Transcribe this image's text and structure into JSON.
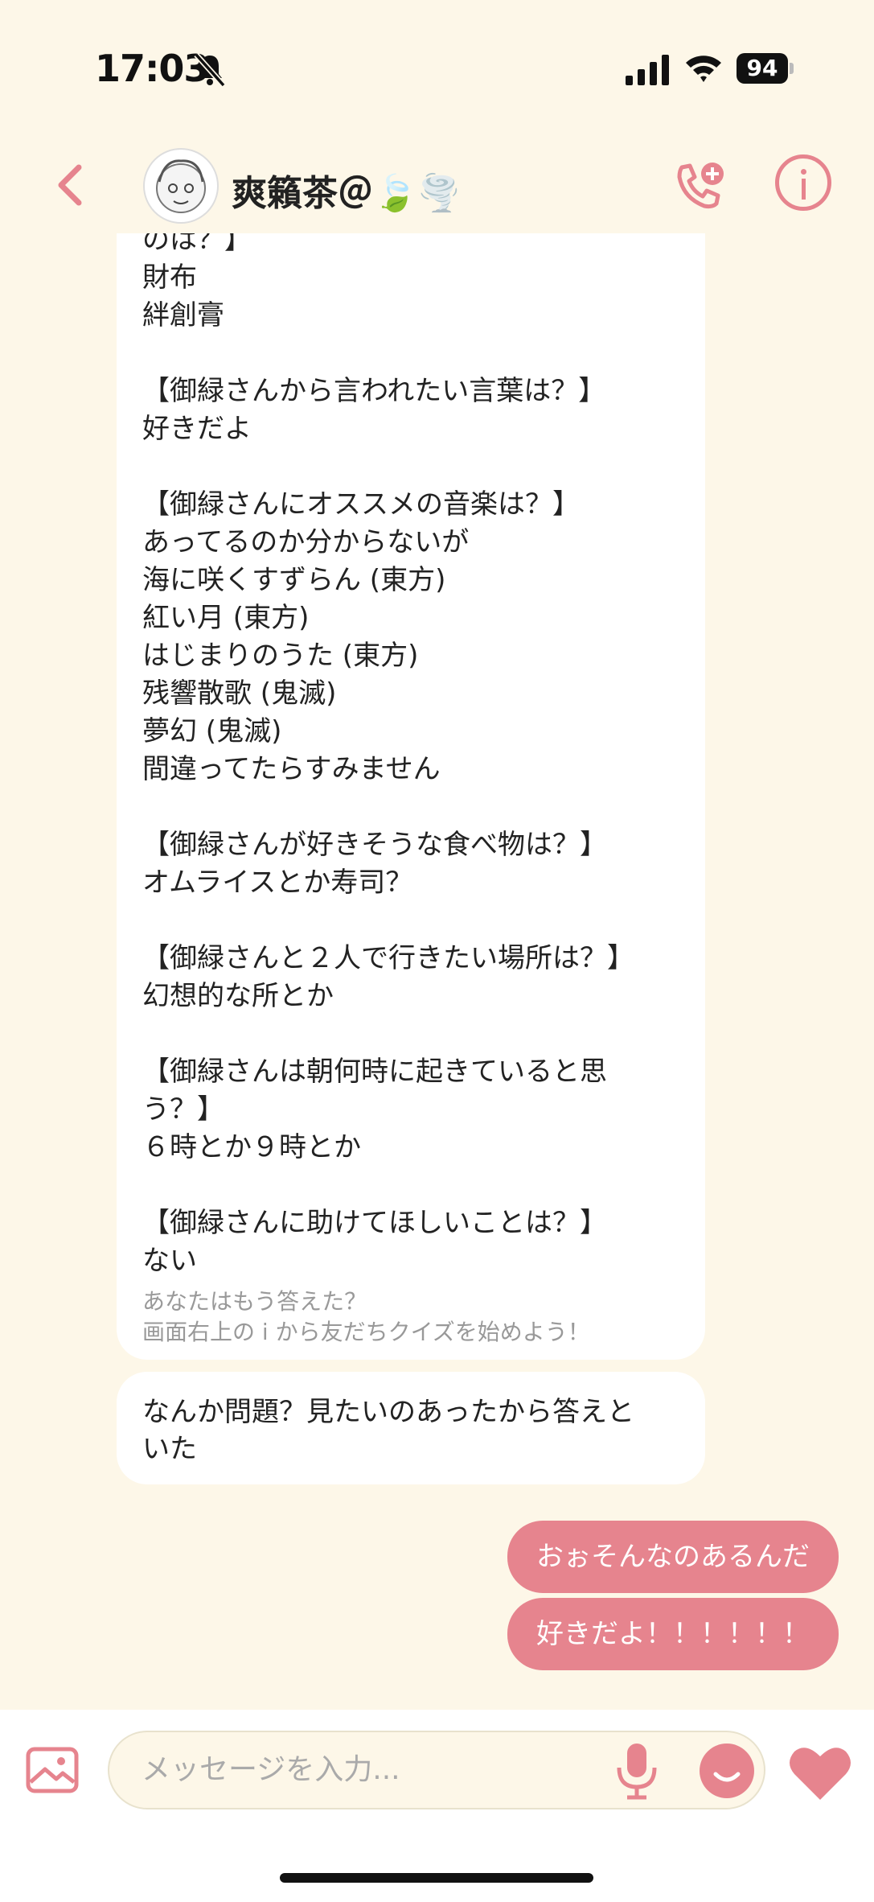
{
  "status": {
    "time": "17:03",
    "battery": "94"
  },
  "header": {
    "name": "爽籟茶＠🍃🌪️"
  },
  "chat": {
    "answer_lines": [
      "のは？】",
      "財布",
      "絆創膏",
      "",
      "【御緑さんから言われたい言葉は？】",
      "好きだよ",
      "",
      "【御緑さんにオススメの音楽は？】",
      "あってるのか分からないが",
      "海に咲くすずらん (東方)",
      "紅い月 (東方)",
      "はじまりのうた (東方)",
      "残響散歌 (鬼滅)",
      "夢幻 (鬼滅)",
      "間違ってたらすみません",
      "",
      "【御緑さんが好きそうな食べ物は？】",
      "オムライスとか寿司？",
      "",
      "【御緑さんと２人で行きたい場所は？】",
      "幻想的な所とか",
      "",
      "【御緑さんは朝何時に起きていると思",
      "う？】",
      "６時とか９時とか",
      "",
      "【御緑さんに助けてほしいことは？】",
      "ない"
    ],
    "quiz_footer": [
      "あなたはもう答えた？",
      "画面右上の i から友だちクイズを始めよう！"
    ],
    "received_message": [
      "なんか問題？見たいのあったから答えと",
      "いた"
    ],
    "sent_messages": [
      "おぉそんなのあるんだ",
      "好きだよ！！！！！！"
    ]
  },
  "input": {
    "placeholder": "メッセージを入力..."
  },
  "colors": {
    "accent": "#e6848e",
    "background": "#fdf7e8"
  }
}
